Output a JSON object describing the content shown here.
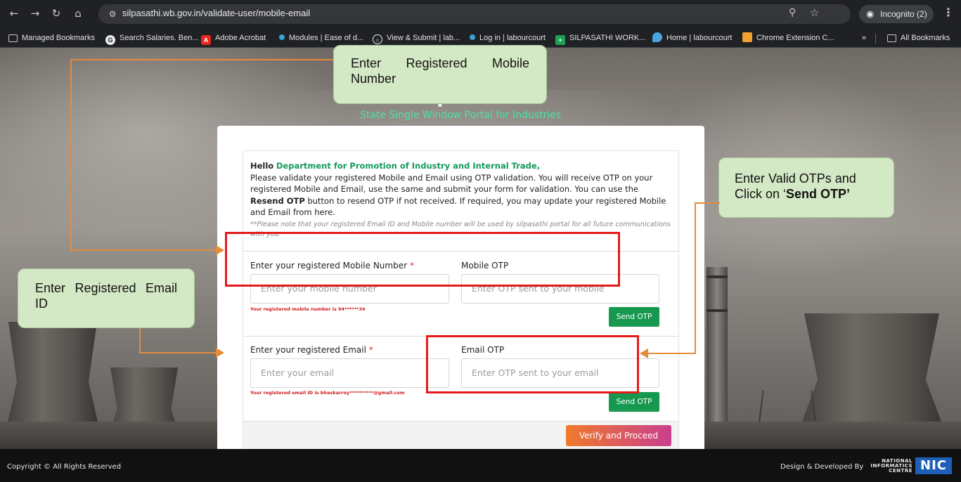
{
  "browser": {
    "url": "silpasathi.wb.gov.in/validate-user/mobile-email",
    "incognito_label": "Incognito (2)",
    "bookmarks": [
      {
        "label": "Managed Bookmarks",
        "icon": "folder-icon"
      },
      {
        "label": "Search Salaries. Ben...",
        "icon": "glassdoor-icon"
      },
      {
        "label": "Adobe Acrobat",
        "icon": "acrobat-icon"
      },
      {
        "label": "Modules | Ease of d...",
        "icon": "dot-icon"
      },
      {
        "label": "View & Submit | lab...",
        "icon": "globe-icon"
      },
      {
        "label": "Log in | labourcourt",
        "icon": "dot-icon"
      },
      {
        "label": "SILPASATHI WORK...",
        "icon": "plus-icon"
      },
      {
        "label": "Home | labourcourt",
        "icon": "drop-icon"
      },
      {
        "label": "Chrome Extension C...",
        "icon": "extension-icon"
      }
    ],
    "overflow_label": "»",
    "all_bookmarks_label": "All Bookmarks"
  },
  "portal": {
    "name": "Silpasathi",
    "tagline": "State Single Window Portal for Industries"
  },
  "form": {
    "greeting": "Hello",
    "org_name": "Department for Promotion of Industry and Internal Trade,",
    "intro_1": "Please validate your registered Mobile and Email using OTP validation. You will receive OTP on your registered Mobile and Email, use the same and submit your form for validation. You can use the",
    "resend_label": "Resend OTP",
    "intro_2": "button to resend OTP if not received. If required, you may update your registered Mobile and Email from here.",
    "note": "**Please note that your registered Email ID and Mobile number will be used by silpasathi portal for all future communications with you.",
    "mobile_label": "Enter your registered Mobile Number",
    "mobile_placeholder": "Enter your mobile number",
    "mobile_hint": "Your registered mobile number is 94******34",
    "mobile_otp_label": "Mobile OTP",
    "mobile_otp_placeholder": "Enter OTP sent to your mobile",
    "send_otp_label": "Send OTP",
    "email_label": "Enter your registered Email",
    "email_placeholder": "Enter your email",
    "email_hint": "Your registered email ID is bhaskarroy**********@gmail.com",
    "email_otp_label": "Email OTP",
    "email_otp_placeholder": "Enter OTP sent to your email",
    "required_mark": "*",
    "verify_label": "Verify and Proceed"
  },
  "footer": {
    "copyright": "Copyright © All Rights Reserved",
    "design": "Design & Developed By",
    "nic_text": "NATIONAL INFORMATICS CENTRE",
    "nic_logo": "NIC"
  },
  "annotations": {
    "mobile_callout": "Enter Registered Mobile Number",
    "email_callout": "Enter Registered Email ID",
    "otp_callout_1": "Enter Valid OTPs and Click on ‘",
    "otp_callout_bold": "Send OTP’"
  },
  "colors": {
    "accent_green": "#149a5a",
    "button_green": "#16994f",
    "verify_gradient_start": "#f07a2b",
    "verify_gradient_end": "#c93f8e",
    "callout_bg": "#d3e8c4",
    "highlight_red": "#e51a1a",
    "connector_orange": "#e58b3a"
  }
}
